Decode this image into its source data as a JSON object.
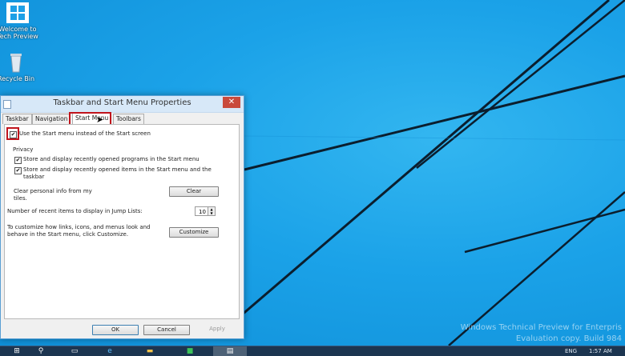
{
  "desktop": {
    "icons": [
      {
        "label": "Welcome to Tech Preview"
      },
      {
        "label": "Recycle Bin"
      }
    ],
    "watermark": {
      "line1": "Windows Technical Preview for Enterpris",
      "line2": "Evaluation copy. Build 984"
    }
  },
  "dialog": {
    "title": "Taskbar and Start Menu Properties",
    "close_glyph": "✕",
    "tabs": [
      {
        "label": "Taskbar"
      },
      {
        "label": "Navigation"
      },
      {
        "label": "Start Menu"
      },
      {
        "label": "Toolbars"
      }
    ],
    "start_menu": {
      "use_start_menu": {
        "label": "Use the Start menu instead of the Start screen",
        "checked": true
      },
      "privacy_heading": "Privacy",
      "recent_programs": {
        "label": "Store and display recently opened programs in the Start menu",
        "checked": true
      },
      "recent_items": {
        "label_line1": "Store and display recently opened items in the Start menu and the",
        "label_line2": "taskbar",
        "checked": true
      },
      "clear_info": {
        "line1": "Clear personal info from my",
        "line2": "tiles.",
        "button": "Clear"
      },
      "jump_lists": {
        "label": "Number of recent items to display in Jump Lists:",
        "value": "10"
      },
      "customize": {
        "line1": "To customize how links, icons, and menus look and",
        "line2": "behave in the Start menu, click Customize.",
        "button": "Customize"
      }
    },
    "buttons": {
      "ok": "OK",
      "cancel": "Cancel",
      "apply": "Apply"
    }
  },
  "taskbar": {
    "tray_lang": "ENG",
    "clock": "1:57 AM"
  },
  "colors": {
    "highlight": "#c0141c",
    "desktop": "#1ea0e6",
    "taskbar": "#1c3550"
  }
}
